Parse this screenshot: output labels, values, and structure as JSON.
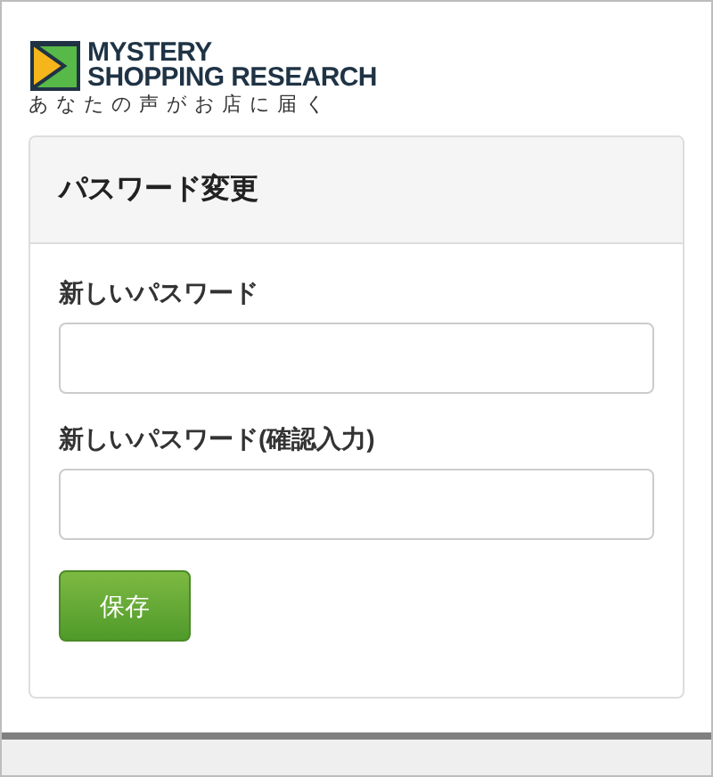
{
  "logo": {
    "line1": "MYSTERY",
    "line2": "SHOPPING RESEARCH",
    "tagline": "あなたの声がお店に届く"
  },
  "card": {
    "title": "パスワード変更",
    "fields": [
      {
        "label": "新しいパスワード"
      },
      {
        "label": "新しいパスワード(確認入力)"
      }
    ],
    "button": "保存"
  }
}
